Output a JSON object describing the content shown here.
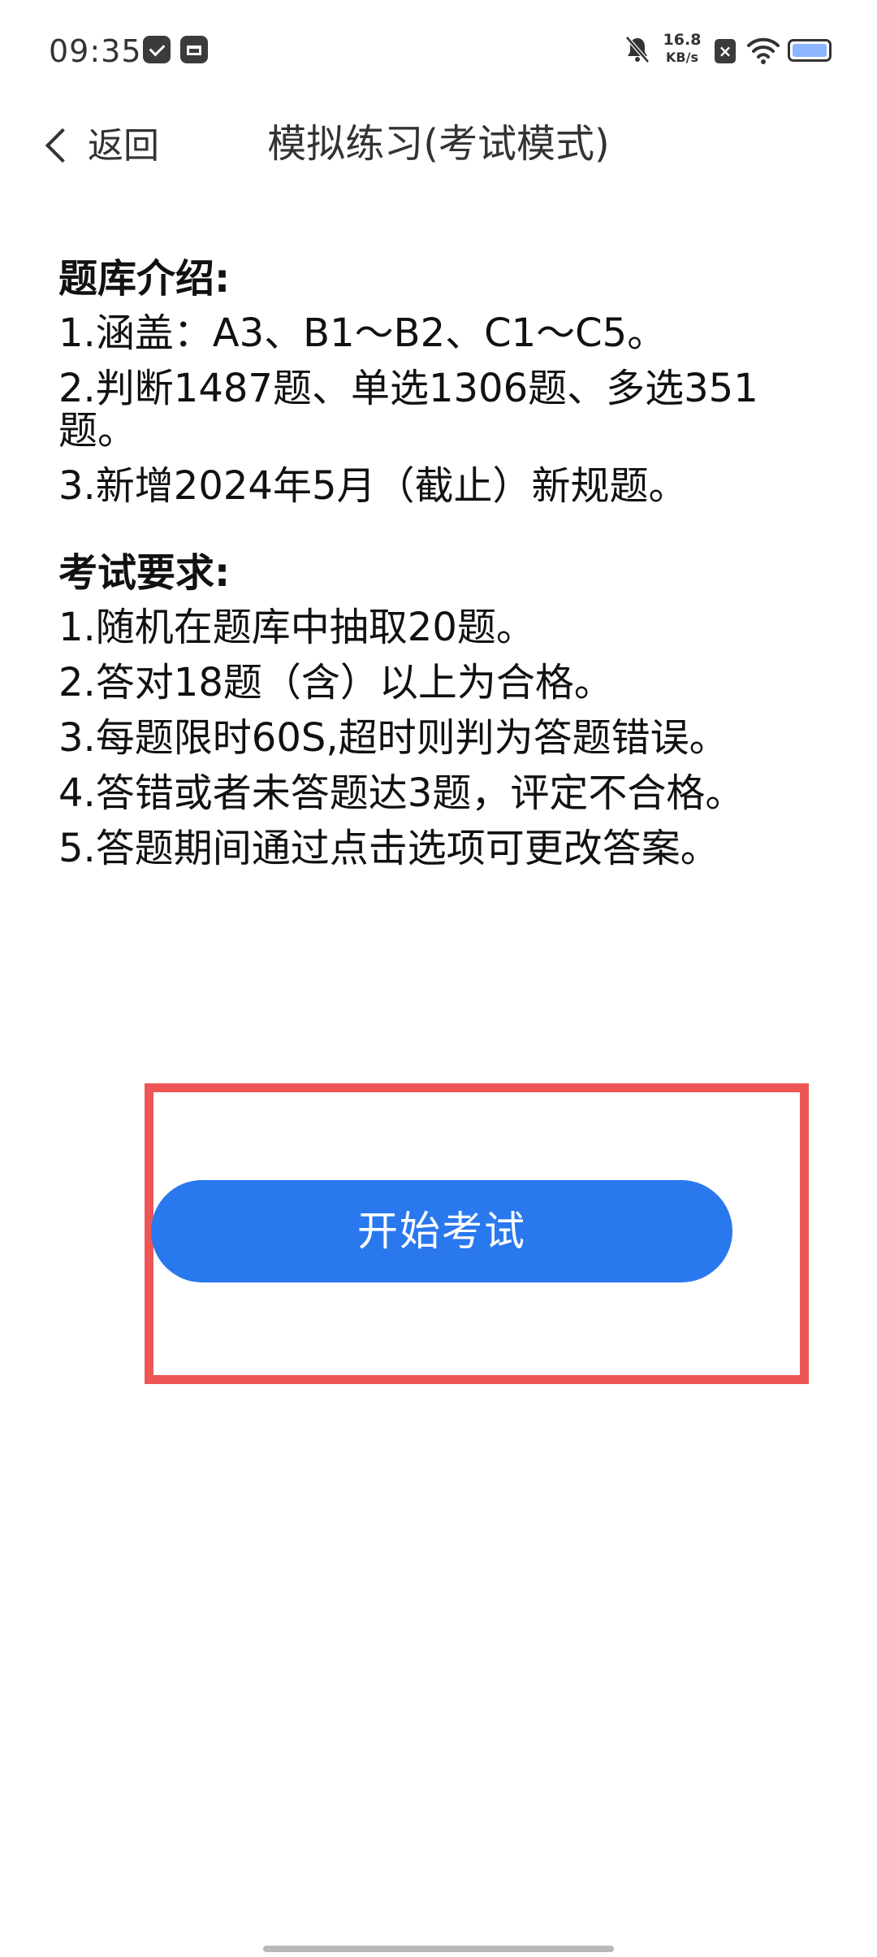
{
  "status_bar": {
    "time": "09:35",
    "net_speed_value": "16.8",
    "net_speed_unit": "KB/s",
    "sim_status": "×",
    "battery_color": "#8cb4ff",
    "icons": [
      "message-notification-icon",
      "box-notification-icon",
      "mute-icon",
      "sim-disabled-icon",
      "wifi-icon",
      "battery-icon"
    ]
  },
  "nav": {
    "back_label": "返回",
    "title": "模拟练习(考试模式)"
  },
  "bank_intro": {
    "title": "题库介绍:",
    "items": [
      "1.涵盖：A3、B1～B2、C1～C5。",
      "2.判断1487题、单选1306题、多选351题。",
      "3.新增2024年5月（截止）新规题。"
    ]
  },
  "exam_rules": {
    "title": "考试要求:",
    "items": [
      "1.随机在题库中抽取20题。",
      "2.答对18题（含）以上为合格。",
      "3.每题限时60S,超时则判为答题错误。",
      "4.答错或者未答题达3题，评定不合格。",
      "5.答题期间通过点击选项可更改答案。"
    ]
  },
  "start_button": {
    "label": "开始考试",
    "color": "#2a78ee",
    "highlight_color": "#ee5656"
  }
}
